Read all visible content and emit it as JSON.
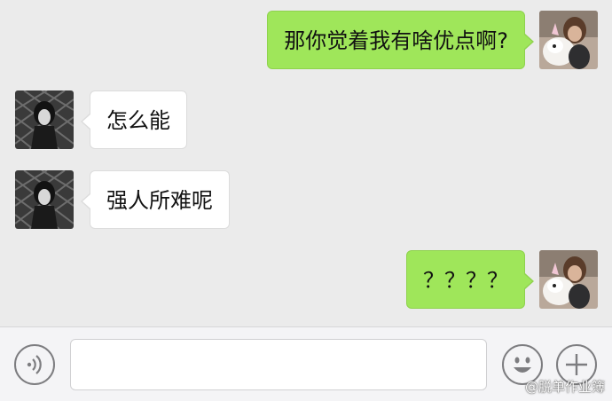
{
  "messages": [
    {
      "side": "right",
      "text": "那你觉着我有啥优点啊?",
      "avatar": "girl-unicorn-avatar"
    },
    {
      "side": "left",
      "text": "怎么能",
      "avatar": "dark-hair-avatar"
    },
    {
      "side": "left",
      "text": "强人所难呢",
      "avatar": "dark-hair-avatar"
    },
    {
      "side": "right",
      "text": "？？？？",
      "avatar": "girl-unicorn-avatar"
    }
  ],
  "toolbar": {
    "voice_icon": "voice-icon",
    "emoji_icon": "emoji-icon",
    "plus_icon": "plus-icon",
    "input_value": ""
  },
  "watermark": "@脱单作业簿",
  "colors": {
    "bubble_right": "#9fe65a",
    "bubble_left": "#ffffff",
    "background": "#ebebeb"
  }
}
